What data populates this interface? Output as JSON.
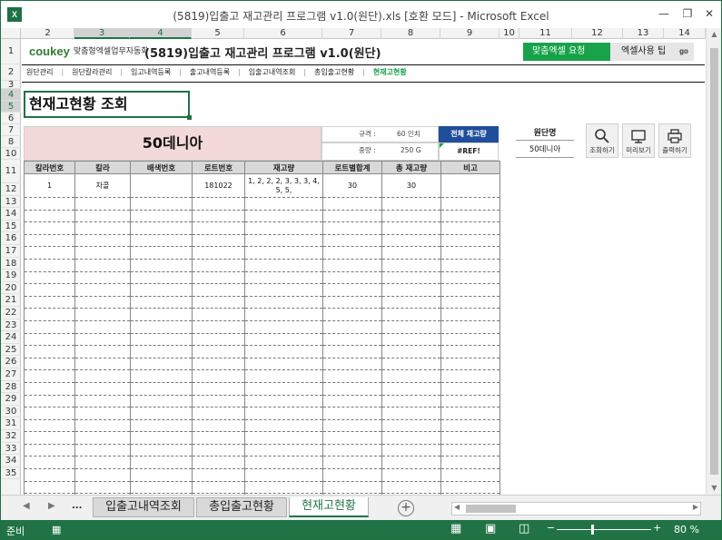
{
  "window": {
    "title": "(5819)입출고 재고관리 프로그램 v1.0(원단).xls  [호환 모드] - Microsoft Excel",
    "app_icon_letter": "X"
  },
  "columns": [
    "2",
    "3",
    "4",
    "5",
    "6",
    "7",
    "8",
    "9",
    "10",
    "11",
    "12",
    "13",
    "14"
  ],
  "rows": [
    "1",
    "2",
    "3",
    "4",
    "5",
    "6",
    "7",
    "8",
    "10",
    "11",
    "12",
    "13",
    "14",
    "15",
    "16",
    "17",
    "18",
    "19",
    "20",
    "21",
    "22",
    "23",
    "24",
    "25",
    "26",
    "27",
    "28",
    "29",
    "30",
    "31",
    "32",
    "33",
    "34",
    "35"
  ],
  "banner": {
    "logo": "coukey",
    "logo_sub": "맞춤형엑셀업무자동화",
    "title": "(5819)입출고 재고관리 프로그램 v1.0(원단)",
    "btn_custom": "맞춤엑셀 요청",
    "btn_tips": "엑셀사용 팁",
    "go": "go"
  },
  "nav": [
    "원단관리",
    "원단칼라관리",
    "입고내역등록",
    "출고내역등록",
    "입출고내역조회",
    "총입출고현황",
    "현재고현황"
  ],
  "nav_current": "현재고현황",
  "page_title": "현재고현황 조회",
  "item_name": "50데니아",
  "spec": {
    "label_size": "규격 :",
    "size": "60 인치",
    "label_weight": "중량 :",
    "weight": "250 G"
  },
  "total": {
    "header": "전체 재고량",
    "value": "#REF!"
  },
  "fabric": {
    "header": "원단명",
    "value": "50데니아"
  },
  "tools": {
    "search": "조회하기",
    "preview": "미리보기",
    "print": "출력하기"
  },
  "table": {
    "headers": [
      "칼라번호",
      "칼라",
      "배색번호",
      "로트번호",
      "재고량",
      "로트별합계",
      "총 재고량",
      "비고"
    ],
    "rows": [
      [
        "1",
        "차콜",
        "",
        "181022",
        "1, 2, 2, 2, 3, 3, 3, 4, 5, 5,",
        "30",
        "30",
        ""
      ]
    ]
  },
  "tabs": {
    "prev": "◀",
    "next": "▶",
    "more": "...",
    "sheets": [
      "입출고내역조회",
      "총입출고현황",
      "현재고현황"
    ],
    "active": "현재고현황"
  },
  "status": {
    "ready": "준비",
    "zoom": "80 %"
  }
}
